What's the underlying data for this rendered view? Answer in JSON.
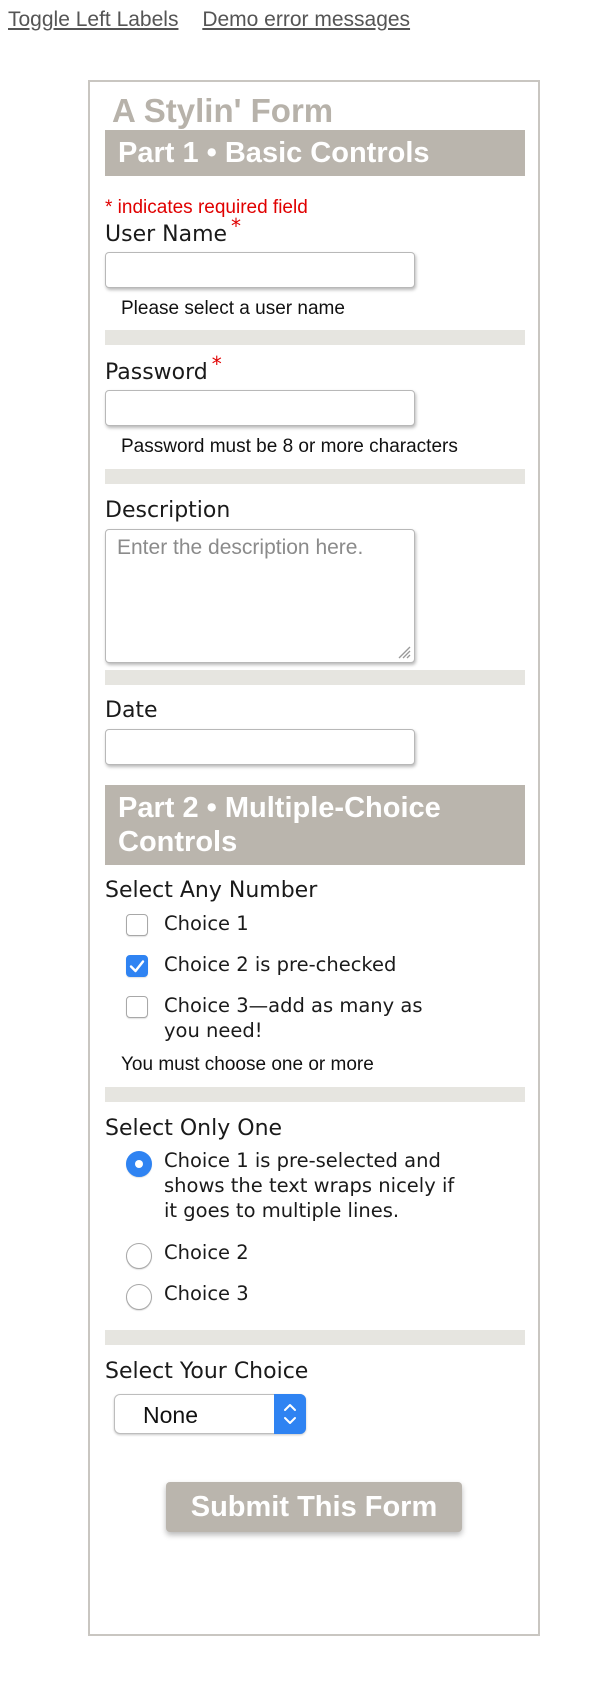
{
  "top_links": {
    "toggle_labels": "Toggle Left Labels",
    "demo_errors": "Demo error messages"
  },
  "form": {
    "title": "A Stylin' Form",
    "part1": {
      "heading": "Part 1 • Basic Controls",
      "required_note": "* indicates required field",
      "username": {
        "label": "User Name",
        "required_mark": "*",
        "value": "",
        "hint": "Please select a user name"
      },
      "password": {
        "label": "Password",
        "required_mark": "*",
        "value": "",
        "hint": "Password must be 8 or more characters"
      },
      "description": {
        "label": "Description",
        "placeholder": "Enter the description here."
      },
      "date": {
        "label": "Date",
        "value": ""
      }
    },
    "part2": {
      "heading": "Part 2 • Multiple-Choice Controls",
      "checkbox_group": {
        "label": "Select Any Number",
        "options": [
          {
            "label": "Choice 1",
            "checked": false
          },
          {
            "label": "Choice 2 is pre-checked",
            "checked": true
          },
          {
            "label": "Choice 3—add as many as you need!",
            "checked": false
          }
        ],
        "hint": "You must choose one or more"
      },
      "radio_group": {
        "label": "Select Only One",
        "options": [
          {
            "label": "Choice 1 is pre-selected and shows the text wraps nicely if it goes to multiple lines.",
            "selected": true
          },
          {
            "label": "Choice 2",
            "selected": false
          },
          {
            "label": "Choice 3",
            "selected": false
          }
        ]
      },
      "select": {
        "label": "Select Your Choice",
        "value": "None"
      }
    },
    "submit_label": "Submit This Form"
  },
  "colors": {
    "accent_blue": "#2f83f2",
    "section_heading_bg": "#bab5ad",
    "divider": "#e6e5e0",
    "required_red": "#e00000",
    "title_gray": "#b7b2aa"
  }
}
